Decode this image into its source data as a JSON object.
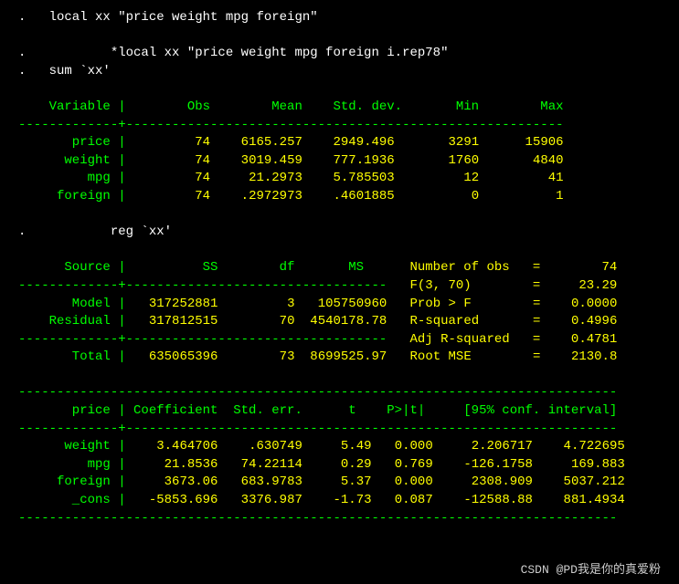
{
  "commands": {
    "c1": ".   local xx \"price weight mpg foreign\"",
    "c2": ".           *local xx \"price weight mpg foreign i.rep78\"",
    "c3": ".   sum `xx'",
    "c4": ".           reg `xx'"
  },
  "sum_table": {
    "headers": [
      "Variable",
      "Obs",
      "Mean",
      "Std. dev.",
      "Min",
      "Max"
    ],
    "rows": [
      {
        "var": "price",
        "obs": "74",
        "mean": "6165.257",
        "sd": "2949.496",
        "min": "3291",
        "max": "15906"
      },
      {
        "var": "weight",
        "obs": "74",
        "mean": "3019.459",
        "sd": "777.1936",
        "min": "1760",
        "max": "4840"
      },
      {
        "var": "mpg",
        "obs": "74",
        "mean": "21.2973",
        "sd": "5.785503",
        "min": "12",
        "max": "41"
      },
      {
        "var": "foreign",
        "obs": "74",
        "mean": ".2972973",
        "sd": ".4601885",
        "min": "0",
        "max": "1"
      }
    ]
  },
  "anova": {
    "headers": [
      "Source",
      "SS",
      "df",
      "MS"
    ],
    "model": {
      "label": "Model",
      "ss": "317252881",
      "df": "3",
      "ms": "105750960"
    },
    "residual": {
      "label": "Residual",
      "ss": "317812515",
      "df": "70",
      "ms": "4540178.78"
    },
    "total": {
      "label": "Total",
      "ss": "635065396",
      "df": "73",
      "ms": "8699525.97"
    }
  },
  "stats": {
    "n_obs": {
      "label": "Number of obs",
      "eq": "=",
      "val": "74"
    },
    "f": {
      "label": "F(3, 70)",
      "eq": "=",
      "val": "23.29"
    },
    "probf": {
      "label": "Prob > F",
      "eq": "=",
      "val": "0.0000"
    },
    "r2": {
      "label": "R-squared",
      "eq": "=",
      "val": "0.4996"
    },
    "adjr2": {
      "label": "Adj R-squared",
      "eq": "=",
      "val": "0.4781"
    },
    "rmse": {
      "label": "Root MSE",
      "eq": "=",
      "val": "2130.8"
    }
  },
  "coef_table": {
    "depvar": "price",
    "headers": [
      "Coefficient",
      "Std. err.",
      "t",
      "P>|t|",
      "[95% conf. interval]"
    ],
    "rows": [
      {
        "var": "weight",
        "coef": "3.464706",
        "se": ".630749",
        "t": "5.49",
        "p": "0.000",
        "lo": "2.206717",
        "hi": "4.722695"
      },
      {
        "var": "mpg",
        "coef": "21.8536",
        "se": "74.22114",
        "t": "0.29",
        "p": "0.769",
        "lo": "-126.1758",
        "hi": "169.883"
      },
      {
        "var": "foreign",
        "coef": "3673.06",
        "se": "683.9783",
        "t": "5.37",
        "p": "0.000",
        "lo": "2308.909",
        "hi": "5037.212"
      },
      {
        "var": "_cons",
        "coef": "-5853.696",
        "se": "3376.987",
        "t": "-1.73",
        "p": "0.087",
        "lo": "-12588.88",
        "hi": "881.4934"
      }
    ]
  },
  "watermark": "CSDN @PD我是你的真爱粉"
}
